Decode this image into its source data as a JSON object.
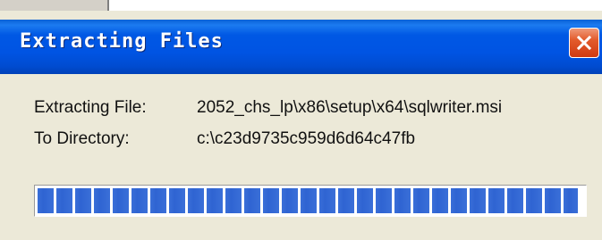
{
  "dialog": {
    "title": "Extracting Files",
    "file_label": "Extracting File:",
    "file_value": "2052_chs_lp\\x86\\setup\\x64\\sqlwriter.msi",
    "dir_label": "To Directory:",
    "dir_value": "c:\\c23d9735c959d6d64c47fb"
  },
  "progress": {
    "percent": 99
  },
  "colors": {
    "titlebar": "#0054e3",
    "close_button": "#e35b2b",
    "progress_block": "#3a6fd8",
    "window": "#ece9d8"
  },
  "icons": {
    "close": "close-icon"
  }
}
